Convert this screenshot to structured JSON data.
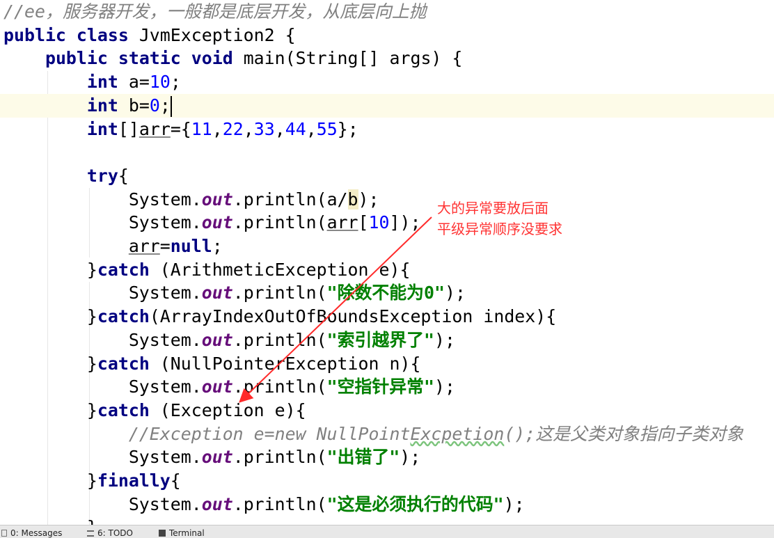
{
  "code": [
    [
      [
        "//ee，服务器开发，一般都是底层开发，从底层向上抛",
        "cm"
      ]
    ],
    [
      [
        "public class ",
        "kw"
      ],
      [
        "JvmException2 {",
        ""
      ]
    ],
    [
      [
        "    ",
        ""
      ],
      [
        "public static void ",
        "kw"
      ],
      [
        "main(String[] args) {",
        ""
      ]
    ],
    [
      [
        "        ",
        ""
      ],
      [
        "int ",
        "kw"
      ],
      [
        "a=",
        ""
      ],
      [
        "10",
        "num"
      ],
      [
        ";",
        ""
      ]
    ],
    [
      [
        "        ",
        ""
      ],
      [
        "int ",
        "kw"
      ],
      [
        "b=",
        ""
      ],
      [
        "0",
        "num"
      ],
      [
        ";",
        ""
      ]
    ],
    [
      [
        "        ",
        ""
      ],
      [
        "int",
        "kw"
      ],
      [
        "[]",
        ""
      ],
      [
        "arr",
        "ul"
      ],
      [
        "={",
        ""
      ],
      [
        "11",
        "num"
      ],
      [
        ",",
        ""
      ],
      [
        "22",
        "num"
      ],
      [
        ",",
        ""
      ],
      [
        "33",
        "num"
      ],
      [
        ",",
        ""
      ],
      [
        "44",
        "num"
      ],
      [
        ",",
        ""
      ],
      [
        "55",
        "num"
      ],
      [
        "};",
        ""
      ]
    ],
    [],
    [
      [
        "        ",
        ""
      ],
      [
        "try",
        "kw"
      ],
      [
        "{",
        ""
      ]
    ],
    [
      [
        "            System.",
        ""
      ],
      [
        "out",
        "field"
      ],
      [
        ".println(a/",
        ""
      ],
      [
        "b",
        "hl"
      ],
      [
        ");",
        ""
      ]
    ],
    [
      [
        "            System.",
        ""
      ],
      [
        "out",
        "field"
      ],
      [
        ".println(",
        ""
      ],
      [
        "arr",
        "ul"
      ],
      [
        "[",
        ""
      ],
      [
        "10",
        "num"
      ],
      [
        "]);",
        ""
      ]
    ],
    [
      [
        "            ",
        ""
      ],
      [
        "arr",
        "ul"
      ],
      [
        "=",
        ""
      ],
      [
        "null",
        "kw"
      ],
      [
        ";",
        ""
      ]
    ],
    [
      [
        "        }",
        ""
      ],
      [
        "catch ",
        "kw"
      ],
      [
        "(ArithmeticException e){",
        ""
      ]
    ],
    [
      [
        "            System.",
        ""
      ],
      [
        "out",
        "field"
      ],
      [
        ".println(",
        ""
      ],
      [
        "\"除数不能为0\"",
        "str"
      ],
      [
        ");",
        ""
      ]
    ],
    [
      [
        "        }",
        ""
      ],
      [
        "catch",
        "kw"
      ],
      [
        "(ArrayIndexOutOfBoundsException index){",
        ""
      ]
    ],
    [
      [
        "            System.",
        ""
      ],
      [
        "out",
        "field"
      ],
      [
        ".println(",
        ""
      ],
      [
        "\"索引越界了\"",
        "str"
      ],
      [
        ");",
        ""
      ]
    ],
    [
      [
        "        }",
        ""
      ],
      [
        "catch ",
        "kw"
      ],
      [
        "(NullPointerException n){",
        ""
      ]
    ],
    [
      [
        "            System.",
        ""
      ],
      [
        "out",
        "field"
      ],
      [
        ".println(",
        ""
      ],
      [
        "\"空指针异常\"",
        "str"
      ],
      [
        ");",
        ""
      ]
    ],
    [
      [
        "        }",
        ""
      ],
      [
        "catch ",
        "kw"
      ],
      [
        "(Exception e){",
        ""
      ]
    ],
    [
      [
        "            ",
        ""
      ],
      [
        "//Exception e=new NullPoint",
        "cm"
      ],
      [
        "Excpetion",
        "cm wavy"
      ],
      [
        "();这是父类对象指向子类对象",
        "cm"
      ]
    ],
    [
      [
        "            System.",
        ""
      ],
      [
        "out",
        "field"
      ],
      [
        ".println(",
        ""
      ],
      [
        "\"出错了\"",
        "str"
      ],
      [
        ");",
        ""
      ]
    ],
    [
      [
        "        }",
        ""
      ],
      [
        "finally",
        "kw"
      ],
      [
        "{",
        ""
      ]
    ],
    [
      [
        "            System.",
        ""
      ],
      [
        "out",
        "field"
      ],
      [
        ".println(",
        ""
      ],
      [
        "\"这是必须执行的代码\"",
        "str"
      ],
      [
        ");",
        ""
      ]
    ],
    [
      [
        "        }",
        ""
      ]
    ]
  ],
  "current_line": 4,
  "annotation": {
    "lines": [
      "大的异常要放后面",
      "平级异常顺序没要求"
    ],
    "color": "#ff3333"
  },
  "statusbar": {
    "tabs": [
      {
        "label": "0: Messages",
        "icon": "messages-icon"
      },
      {
        "label": "6: TODO",
        "icon": "todo-list-icon"
      },
      {
        "label": "Terminal",
        "icon": "terminal-icon"
      }
    ]
  }
}
